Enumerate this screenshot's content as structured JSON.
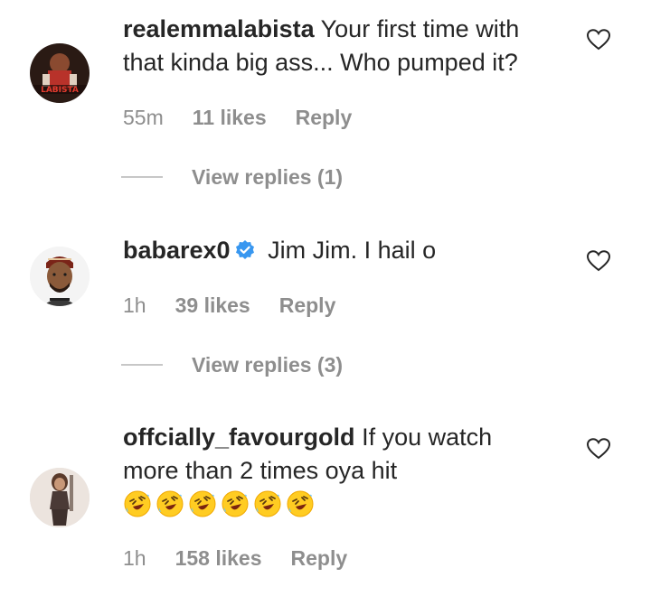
{
  "comments": [
    {
      "username": "realemmalabista",
      "text": "Your first time with that kinda big ass... Who pumped it?",
      "verified": false,
      "time": "55m",
      "likes": "11 likes",
      "reply": "Reply",
      "view_replies": "View replies (1)",
      "avatar_icon": "user-avatar-poster",
      "avatar_text": "LABISTA"
    },
    {
      "username": "babarex0",
      "text": "Jim Jim. I hail o",
      "verified": true,
      "time": "1h",
      "likes": "39 likes",
      "reply": "Reply",
      "view_replies": "View replies (3)",
      "avatar_icon": "user-avatar-cartoon-man"
    },
    {
      "username": "offcially_favourgold",
      "text": "If you watch more than 2 times oya hit",
      "emojis": [
        "rofl",
        "rofl",
        "rofl",
        "rofl",
        "rofl",
        "rofl"
      ],
      "verified": false,
      "time": "1h",
      "likes": "158 likes",
      "reply": "Reply",
      "avatar_icon": "user-avatar-woman"
    }
  ],
  "colors": {
    "text": "#262626",
    "meta": "#8e8e8e",
    "verified": "#3897f0",
    "divider": "#c7c7c7"
  }
}
